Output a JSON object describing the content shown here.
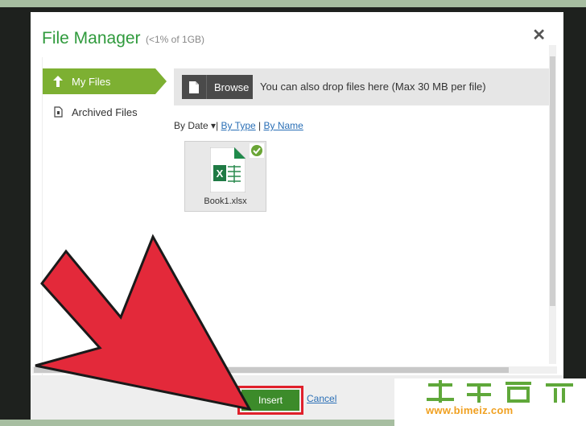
{
  "dialog": {
    "title": "File Manager",
    "quota": "(<1% of 1GB)",
    "close_symbol": "✕"
  },
  "sidebar": {
    "items": [
      {
        "label": "My Files",
        "icon": "upload-arrow-icon",
        "active": true
      },
      {
        "label": "Archived Files",
        "icon": "archive-document-icon",
        "active": false
      }
    ]
  },
  "dropbar": {
    "browse_label": "Browse",
    "drop_text": "You can also drop files here (Max 30 MB per file)"
  },
  "sort": {
    "current": "By Date",
    "sep1": "|",
    "by_type": "By Type",
    "sep2": "|",
    "by_name": "By Name"
  },
  "files": [
    {
      "name": "Book1.xlsx",
      "icon": "excel-file-icon",
      "selected": true
    }
  ],
  "footer": {
    "insert_label": "Insert",
    "cancel_label": "Cancel"
  },
  "watermark": {
    "url": "www.bimeiz.com"
  },
  "colors": {
    "accent_green": "#7db032",
    "title_green": "#2f9a3c",
    "insert_green": "#3c8b2a",
    "highlight_red": "#e0202b",
    "arrow_red": "#e3293a"
  }
}
